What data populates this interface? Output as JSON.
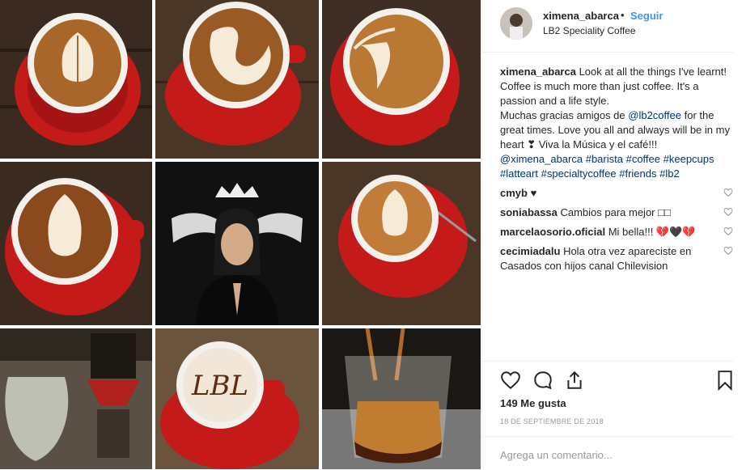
{
  "post": {
    "username": "ximena_abarca",
    "separator": "•",
    "follow_label": "Seguir",
    "location": "LB2 Speciality Coffee",
    "caption": {
      "username": "ximena_abarca",
      "text1": "Look at all the things I've learnt!",
      "text2": "Coffee is much more than just coffee. It's a passion and a life style.",
      "text3a": "Muchas gracias amigos de",
      "mention1": "@lb2coffee",
      "text3b": "for the great times. Love you all and always will be in my heart ❣ Viva la Música y el café!!!",
      "tags": [
        "@ximena_abarca",
        "#barista",
        "#coffee",
        "#keepcups",
        "#latteart",
        "#specialtycoffee",
        "#friends",
        "#lb2"
      ]
    },
    "comments": [
      {
        "user": "cmyb",
        "text": "♥"
      },
      {
        "user": "soniabassa",
        "text": "Cambios para mejor □□"
      },
      {
        "user": "marcelaosorio.oficial",
        "text": "Mi bella!!! 💔🖤💔"
      },
      {
        "user": "cecimiadalu",
        "text": "Hola otra vez apareciste en Casados con hijos canal Chilevision"
      }
    ],
    "likes": "149 Me gusta",
    "date": "18 DE SEPTIEMBRE DE 2018",
    "comment_placeholder": "Agrega un comentario..."
  },
  "image_tiles": [
    {
      "name": "latte-art-tile-1",
      "art": "tulip"
    },
    {
      "name": "latte-art-tile-2",
      "art": "swan"
    },
    {
      "name": "latte-art-tile-3",
      "art": "rosetta"
    },
    {
      "name": "latte-art-tile-4",
      "art": "tulip"
    },
    {
      "name": "portrait-tile",
      "crown": "LB2"
    },
    {
      "name": "latte-art-tile-6",
      "art": "tulip"
    },
    {
      "name": "brewing-equipment-tile"
    },
    {
      "name": "lb2-cappuccino-tile",
      "art_text": "LB2"
    },
    {
      "name": "espresso-shot-tile"
    }
  ],
  "colors": {
    "cup_red": "#c41a1a",
    "accent_blue": "#3897f0",
    "text": "#262626",
    "muted": "#999999",
    "link": "#003569"
  }
}
